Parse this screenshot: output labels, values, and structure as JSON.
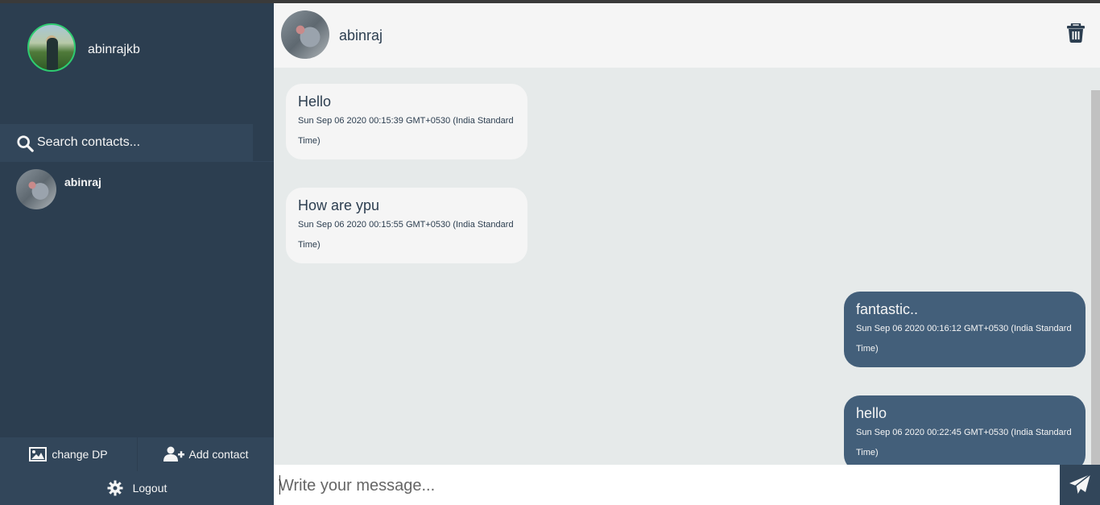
{
  "user": {
    "name": "abinrajkb"
  },
  "search": {
    "placeholder": "Search contacts..."
  },
  "contacts": [
    {
      "name": "abinraj"
    }
  ],
  "chat": {
    "contact_name": "abinraj",
    "messages": [
      {
        "direction": "received",
        "text": "Hello",
        "time": "Sun Sep 06 2020 00:15:39 GMT+0530 (India Standard Time)"
      },
      {
        "direction": "received",
        "text": "How are ypu",
        "time": "Sun Sep 06 2020 00:15:55 GMT+0530 (India Standard Time)"
      },
      {
        "direction": "sent",
        "text": "fantastic..",
        "time": "Sun Sep 06 2020 00:16:12 GMT+0530 (India Standard Time)"
      },
      {
        "direction": "sent",
        "text": "hello",
        "time": "Sun Sep 06 2020 00:22:45 GMT+0530 (India Standard Time)"
      }
    ]
  },
  "composer": {
    "placeholder": "Write your message..."
  },
  "bottom_bar": {
    "change_dp_label": "change DP",
    "add_contact_label": "Add contact",
    "logout_label": "Logout"
  },
  "icons": {
    "search": "search-icon",
    "trash": "trash-icon",
    "send": "paper-plane-icon",
    "image": "image-icon",
    "add_user": "user-plus-icon",
    "settings": "gear-icon"
  },
  "colors": {
    "sidebar": "#2c3e50",
    "sent_bubble": "#435f7a",
    "received_bubble": "#f5f5f5",
    "online_ring": "#2ecc71"
  }
}
